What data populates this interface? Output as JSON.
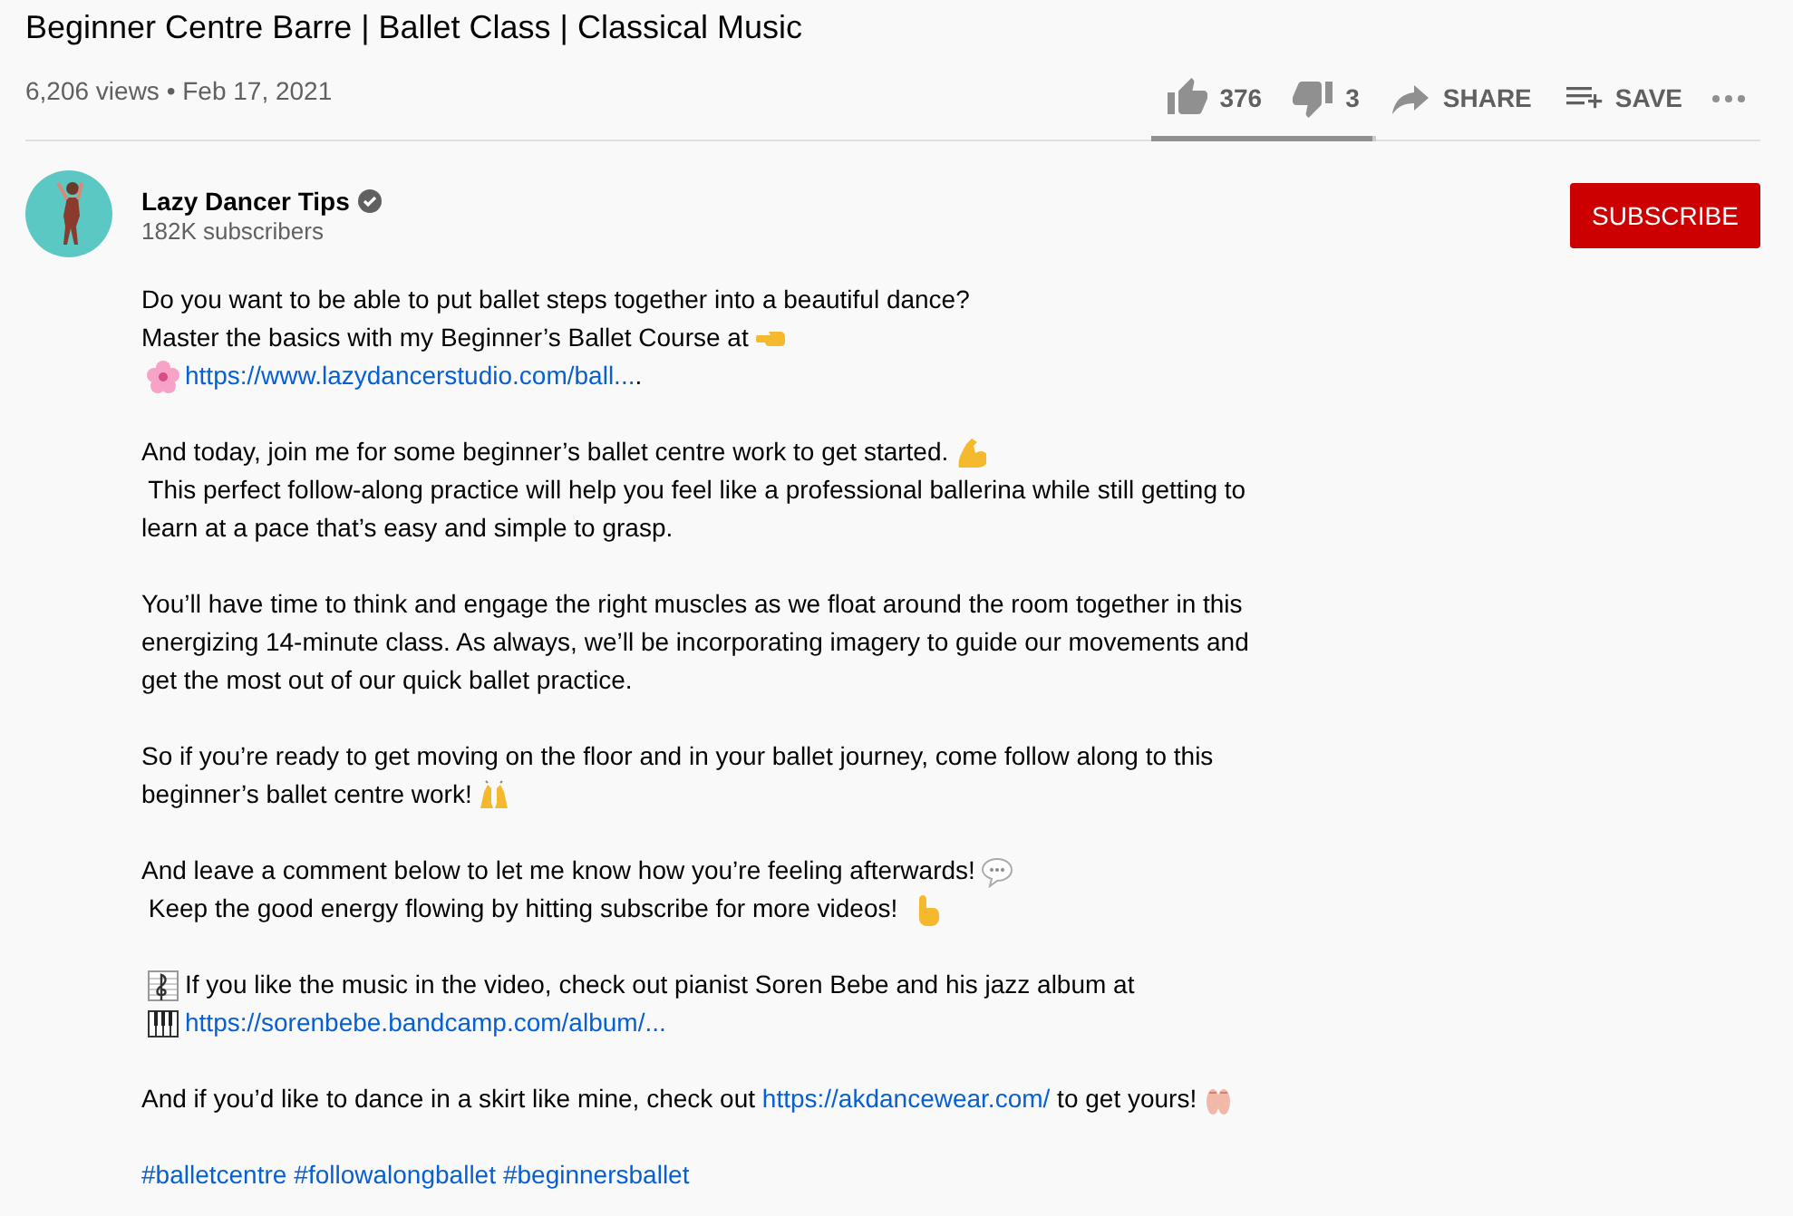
{
  "video": {
    "title": "Beginner Centre Barre | Ballet Class | Classical Music",
    "meta": "6,206 views • Feb 17, 2021"
  },
  "actions": [
    {
      "kind": "like",
      "label": "376"
    },
    {
      "kind": "dislike",
      "label": "3"
    },
    {
      "kind": "share",
      "label": "SHARE"
    },
    {
      "kind": "save",
      "label": "SAVE"
    },
    {
      "kind": "more"
    }
  ],
  "like_ratio": {
    "level": 0.99
  },
  "channel": {
    "name": "Lazy Dancer Tips",
    "verified": true,
    "subscribers": "182K subscribers",
    "subscribe_label": "SUBSCRIBE"
  },
  "description": [
    [
      [
        {
          "kind": "text",
          "text": "Do you want to be able to put ballet steps together into a beautiful dance?"
        }
      ],
      [
        {
          "kind": "text",
          "text": "Master the basics with my Beginner’s Ballet Course at"
        },
        {
          "kind": "point-left"
        }
      ],
      [
        {
          "kind": "flower"
        },
        {
          "kind": "link",
          "text": "https://www.lazydancerstudio.com/ball..."
        },
        {
          "kind": "text",
          "text": "."
        }
      ]
    ],
    [
      [
        {
          "kind": "text",
          "text": "And today, join me for some beginner’s ballet centre work to get started."
        },
        {
          "kind": "flex"
        }
      ],
      [
        {
          "kind": "text",
          "text": " This perfect follow-along practice will help you feel like a professional ballerina while still getting to"
        }
      ],
      [
        {
          "kind": "text",
          "text": "learn at a pace that’s easy and simple to grasp."
        }
      ]
    ],
    [
      [
        {
          "kind": "text",
          "text": "You’ll have time to think and engage the right muscles as we float around the room together in this"
        }
      ],
      [
        {
          "kind": "text",
          "text": "energizing 14-minute class. As always, we’ll be incorporating imagery to guide our movements and"
        }
      ],
      [
        {
          "kind": "text",
          "text": "get the most out of our quick ballet practice."
        }
      ]
    ],
    [
      [
        {
          "kind": "text",
          "text": "So if you’re ready to get moving on the floor and in your ballet journey, come follow along to this"
        }
      ],
      [
        {
          "kind": "text",
          "text": "beginner’s ballet centre work!"
        },
        {
          "kind": "raised-hands"
        }
      ]
    ],
    [
      [
        {
          "kind": "text",
          "text": "And leave a comment below to let me know how you’re feeling afterwards!"
        },
        {
          "kind": "speech"
        }
      ],
      [
        {
          "kind": "text",
          "text": " Keep the good energy flowing by hitting subscribe for more videos! "
        },
        {
          "kind": "point-up"
        }
      ]
    ],
    [
      [
        {
          "kind": "score"
        },
        {
          "kind": "text",
          "text": "If you like the music in the video, check out pianist Soren Bebe and his jazz album at"
        }
      ],
      [
        {
          "kind": "piano"
        },
        {
          "kind": "link",
          "text": "https://sorenbebe.bandcamp.com/album/..."
        }
      ]
    ],
    [
      [
        {
          "kind": "text",
          "text": "And if you’d like to dance in a skirt like mine, check out "
        },
        {
          "kind": "link",
          "text": "https://akdancewear.com/"
        },
        {
          "kind": "text",
          "text": " to get yours!"
        },
        {
          "kind": "shoes"
        }
      ]
    ],
    [
      [
        {
          "kind": "link",
          "text": "#balletcentre"
        },
        {
          "kind": "link",
          "text": "#followalongballet"
        },
        {
          "kind": "link",
          "text": "#beginnersballet"
        }
      ]
    ]
  ]
}
